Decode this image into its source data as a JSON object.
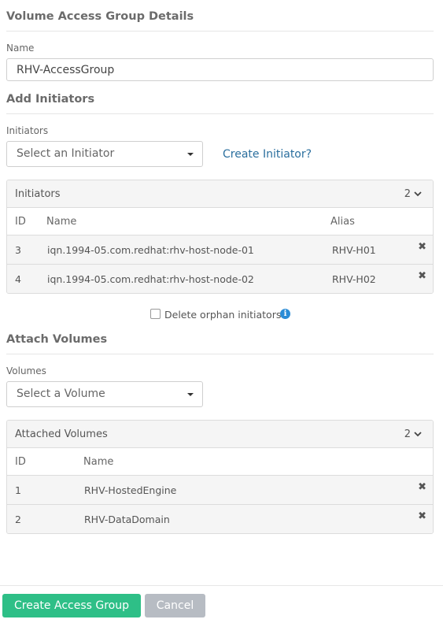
{
  "details": {
    "title": "Volume Access Group Details"
  },
  "name_field": {
    "label": "Name",
    "value": "RHV-AccessGroup"
  },
  "add_initiators": {
    "title": "Add Initiators",
    "label": "Initiators",
    "select_placeholder": "Select an Initiator",
    "create_link": "Create Initiator?"
  },
  "initiators_panel": {
    "title": "Initiators",
    "count": "2",
    "columns": {
      "id": "ID",
      "name": "Name",
      "alias": "Alias"
    },
    "rows": [
      {
        "id": "3",
        "name": "iqn.1994-05.com.redhat:rhv-host-node-01",
        "alias": "RHV-H01"
      },
      {
        "id": "4",
        "name": "iqn.1994-05.com.redhat:rhv-host-node-02",
        "alias": "RHV-H02"
      }
    ]
  },
  "orphan": {
    "label": "Delete orphan initiators",
    "checked": false
  },
  "attach_volumes": {
    "title": "Attach Volumes",
    "label": "Volumes",
    "select_placeholder": "Select a Volume"
  },
  "volumes_panel": {
    "title": "Attached Volumes",
    "count": "2",
    "columns": {
      "id": "ID",
      "name": "Name"
    },
    "rows": [
      {
        "id": "1",
        "name": "RHV-HostedEngine"
      },
      {
        "id": "2",
        "name": "RHV-DataDomain"
      }
    ]
  },
  "icons": {
    "remove": "close-icon",
    "info": "info-icon",
    "expand": "chevron-down-icon",
    "dropdown": "caret-down-icon"
  },
  "colors": {
    "primary": "#2ebf87",
    "secondary": "#b7bcc3",
    "link": "#2b6f9e",
    "info": "#2b8cd6"
  },
  "footer": {
    "create_label": "Create Access Group",
    "cancel_label": "Cancel"
  }
}
